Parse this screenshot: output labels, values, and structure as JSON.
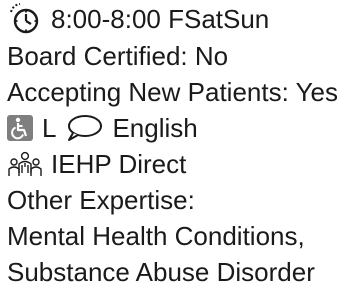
{
  "hours": {
    "icon": "clock-icon",
    "text": "8:00-8:00 FSatSun"
  },
  "board_certified": "Board Certified: No",
  "accepting_new_patients": "Accepting New Patients: Yes",
  "accessibility": {
    "icon": "wheelchair-accessible-icon",
    "code": "L",
    "language_icon": "speech-bubble-icon",
    "language": "English"
  },
  "plan": {
    "icon": "group-people-icon",
    "name": "IEHP Direct"
  },
  "expertise": {
    "heading": "Other Expertise:",
    "line1": "Mental Health Conditions,",
    "line2": "Substance Abuse Disorder"
  }
}
